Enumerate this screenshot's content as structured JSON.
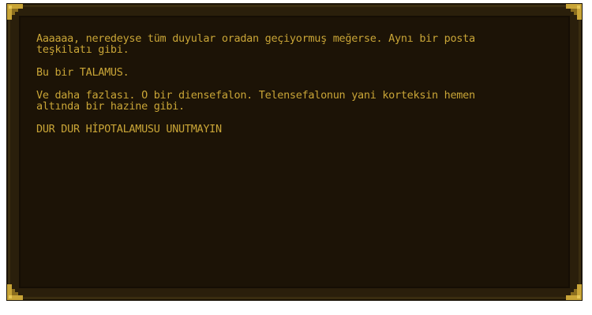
{
  "dialog": {
    "paragraphs": [
      "Aaaaaa, neredeyse tüm duyular oradan geçiyormuş meğerse. Aynı bir posta\nteşkilatı gibi.",
      "Bu bir TALAMUS.",
      "Ve daha fazlası. O bir diensefalon. Telensefalonun yani korteksin hemen\naltında bir hazine gibi.",
      "DUR DUR HİPOTALAMUSU UNUTMAYIN"
    ]
  },
  "colors": {
    "text": "#c9a537",
    "panel": "#1c1306",
    "frame": "#2a1f0b",
    "corner_gold": "#c9a537"
  }
}
